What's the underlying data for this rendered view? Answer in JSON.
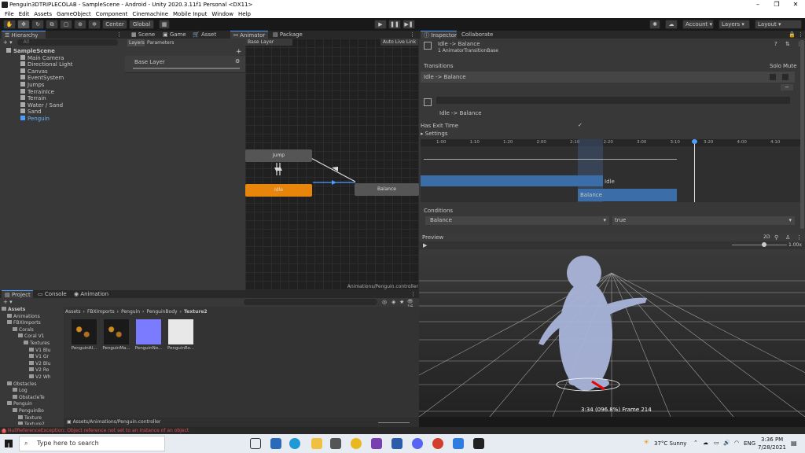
{
  "window": {
    "title": "Penguin3DTRIPLECOLAB - SampleScene - Android - Unity 2020.3.11f1 Personal <DX11>"
  },
  "menu": [
    "File",
    "Edit",
    "Assets",
    "GameObject",
    "Component",
    "Cinemachine",
    "Mobile Input",
    "Window",
    "Help"
  ],
  "toolbar": {
    "center": "Center",
    "global": "Global",
    "account": "Account",
    "layers": "Layers",
    "layout": "Layout"
  },
  "hierarchy": {
    "tab": "Hierarchy",
    "search_placeholder": "All",
    "items": [
      {
        "label": "SampleScene",
        "depth": 0
      },
      {
        "label": "Main Camera",
        "depth": 1
      },
      {
        "label": "Directional Light",
        "depth": 1
      },
      {
        "label": "Canvas",
        "depth": 1
      },
      {
        "label": "EventSystem",
        "depth": 1
      },
      {
        "label": "Jumps",
        "depth": 1
      },
      {
        "label": "TerrainIce",
        "depth": 1
      },
      {
        "label": "Terrain",
        "depth": 1
      },
      {
        "label": "Water / Sand",
        "depth": 1
      },
      {
        "label": "Sand",
        "depth": 1
      },
      {
        "label": "Penguin",
        "depth": 1
      }
    ]
  },
  "center_tabs": [
    "Scene",
    "Game",
    "Asset Store",
    "Animator",
    "Package Manager"
  ],
  "animator": {
    "layers_tab": "Layers",
    "parameters_tab": "Parameters",
    "base_layer_crumb": "Base Layer",
    "auto_live_link": "Auto Live Link",
    "layer_name": "Base Layer",
    "nodes": {
      "jump": "Jump",
      "idle": "Idle",
      "balance": "Balance"
    },
    "footer_path": "Animations/Penguin.controller"
  },
  "inspector": {
    "tabs": [
      "Inspector",
      "Collaborate"
    ],
    "header_title": "Idle -> Balance",
    "header_subtitle": "1 AnimatorTransitionBase",
    "transitions_label": "Transitions",
    "solo_label": "Solo",
    "mute_label": "Mute",
    "transition_row": "Idle -> Balance",
    "transition_name": "Idle -> Balance",
    "has_exit_time_label": "Has Exit Time",
    "settings_label": "Settings",
    "timeline_ticks": [
      "1:00",
      "1:10",
      "1:20",
      "2:00",
      "2:10",
      "2:20",
      "3:00",
      "3:10",
      "3:20",
      "4:00",
      "4:10"
    ],
    "track_idle": "Idle",
    "track_balance": "Balance",
    "conditions_label": "Conditions",
    "condition_param": "Balance",
    "condition_value": "true",
    "preview_label": "Preview",
    "preview_2d": "2D",
    "preview_speed": "1.00x",
    "preview_time": "3:34 (096.8%) Frame 214"
  },
  "project": {
    "tabs": [
      "Project",
      "Console",
      "Animation"
    ],
    "tree": [
      {
        "label": "Assets",
        "depth": 0
      },
      {
        "label": "Animations",
        "depth": 1
      },
      {
        "label": "FBXImports",
        "depth": 1
      },
      {
        "label": "Corals",
        "depth": 2
      },
      {
        "label": "Coral V1",
        "depth": 3
      },
      {
        "label": "Textures",
        "depth": 4
      },
      {
        "label": "V1 Blu",
        "depth": 5
      },
      {
        "label": "V1 Gr",
        "depth": 5
      },
      {
        "label": "V2 Blu",
        "depth": 5
      },
      {
        "label": "V2 Ro",
        "depth": 5
      },
      {
        "label": "V2 Wh",
        "depth": 5
      },
      {
        "label": "Obstacles",
        "depth": 1
      },
      {
        "label": "Log",
        "depth": 2
      },
      {
        "label": "ObstacleTe",
        "depth": 2
      },
      {
        "label": "Penguin",
        "depth": 1
      },
      {
        "label": "PenguinBo",
        "depth": 2
      },
      {
        "label": "Texture",
        "depth": 3
      },
      {
        "label": "Texture2",
        "depth": 3
      }
    ],
    "breadcrumb": [
      "Assets",
      "FBXImports",
      "Penguin",
      "PenguinBody",
      "Texture2"
    ],
    "assets": [
      "PenguinAl...",
      "PenguinMa...",
      "PenguinNo...",
      "PenguinRo..."
    ],
    "footer_path": "Assets/Animations/Penguin.controller",
    "count": "16"
  },
  "console_error": "NullReferenceException: Object reference not set to an instance of an object",
  "taskbar": {
    "search": "Type here to search",
    "weather": "37°C  Sunny",
    "lang": "ENG",
    "time": "3:36 PM",
    "date": "7/28/2021"
  },
  "colors": {
    "accent": "#4a9eff",
    "idle_node": "#e8860b",
    "timeline_blue": "#3b6ea8",
    "error": "#e04a4a"
  }
}
